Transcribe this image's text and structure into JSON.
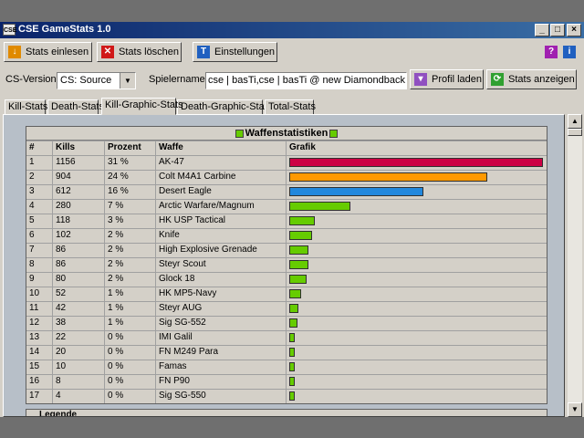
{
  "window": {
    "title": "CSE GameStats 1.0",
    "app_icon": "CSE"
  },
  "titlebar_buttons": {
    "minimize": "_",
    "maximize": "□",
    "close": "×"
  },
  "toolbar": {
    "read_label": "Stats einlesen",
    "delete_label": "Stats löschen",
    "settings_label": "Einstellungen"
  },
  "options": {
    "cs_version_label": "CS-Version:",
    "cs_version_value": "CS: Source",
    "player_names_label": "Spielernamen:",
    "player_names_value": "cse | basTi,cse | basTi @ new Diamondback,hallo c",
    "load_profile_label": "Profil laden",
    "show_stats_label": "Stats anzeigen"
  },
  "tabs": [
    "Kill-Stats",
    "Death-Stats",
    "Kill-Graphic-Stats",
    "Death-Graphic-Stats",
    "Total-Stats"
  ],
  "active_tab": 2,
  "table": {
    "caption": "Waffenstatistiken",
    "headers": [
      "#",
      "Kills",
      "Prozent",
      "Waffe",
      "Grafik"
    ],
    "max_kills": 1156,
    "rows": [
      {
        "rank": "1",
        "kills": "1156",
        "pct": "31 %",
        "weapon": "AK-47",
        "color": "#cc0044"
      },
      {
        "rank": "2",
        "kills": "904",
        "pct": "24 %",
        "weapon": "Colt M4A1 Carbine",
        "color": "#ff9900"
      },
      {
        "rank": "3",
        "kills": "612",
        "pct": "16 %",
        "weapon": "Desert Eagle",
        "color": "#2288dd"
      },
      {
        "rank": "4",
        "kills": "280",
        "pct": "7 %",
        "weapon": "Arctic Warfare/Magnum",
        "color": "#66cc00"
      },
      {
        "rank": "5",
        "kills": "118",
        "pct": "3 %",
        "weapon": "HK USP Tactical",
        "color": "#66cc00"
      },
      {
        "rank": "6",
        "kills": "102",
        "pct": "2 %",
        "weapon": "Knife",
        "color": "#66cc00"
      },
      {
        "rank": "7",
        "kills": "86",
        "pct": "2 %",
        "weapon": "High Explosive Grenade",
        "color": "#66cc00"
      },
      {
        "rank": "8",
        "kills": "86",
        "pct": "2 %",
        "weapon": "Steyr Scout",
        "color": "#66cc00"
      },
      {
        "rank": "9",
        "kills": "80",
        "pct": "2 %",
        "weapon": "Glock 18",
        "color": "#66cc00"
      },
      {
        "rank": "10",
        "kills": "52",
        "pct": "1 %",
        "weapon": "HK MP5-Navy",
        "color": "#66cc00"
      },
      {
        "rank": "11",
        "kills": "42",
        "pct": "1 %",
        "weapon": "Steyr AUG",
        "color": "#66cc00"
      },
      {
        "rank": "12",
        "kills": "38",
        "pct": "1 %",
        "weapon": "Sig SG-552",
        "color": "#66cc00"
      },
      {
        "rank": "13",
        "kills": "22",
        "pct": "0 %",
        "weapon": "IMI Galil",
        "color": "#66cc00"
      },
      {
        "rank": "14",
        "kills": "20",
        "pct": "0 %",
        "weapon": "FN M249 Para",
        "color": "#66cc00"
      },
      {
        "rank": "15",
        "kills": "10",
        "pct": "0 %",
        "weapon": "Famas",
        "color": "#66cc00"
      },
      {
        "rank": "16",
        "kills": "8",
        "pct": "0 %",
        "weapon": "FN P90",
        "color": "#66cc00"
      },
      {
        "rank": "17",
        "kills": "4",
        "pct": "0 %",
        "weapon": "Sig SG-550",
        "color": "#66cc00"
      }
    ]
  },
  "legend": {
    "label": "Legende"
  },
  "colors": {
    "title_start": "#0a246a",
    "title_end": "#3a6ea5",
    "panel_bg": "#b7bfc8",
    "bar_green": "#66cc00",
    "bar_red": "#cc0044",
    "bar_orange": "#ff9900",
    "bar_blue": "#2288dd"
  },
  "icons": {
    "read": "download-icon",
    "delete": "delete-icon",
    "settings": "settings-icon",
    "help": "help-icon",
    "info": "info-icon",
    "profile": "profile-icon",
    "show": "show-stats-icon"
  }
}
